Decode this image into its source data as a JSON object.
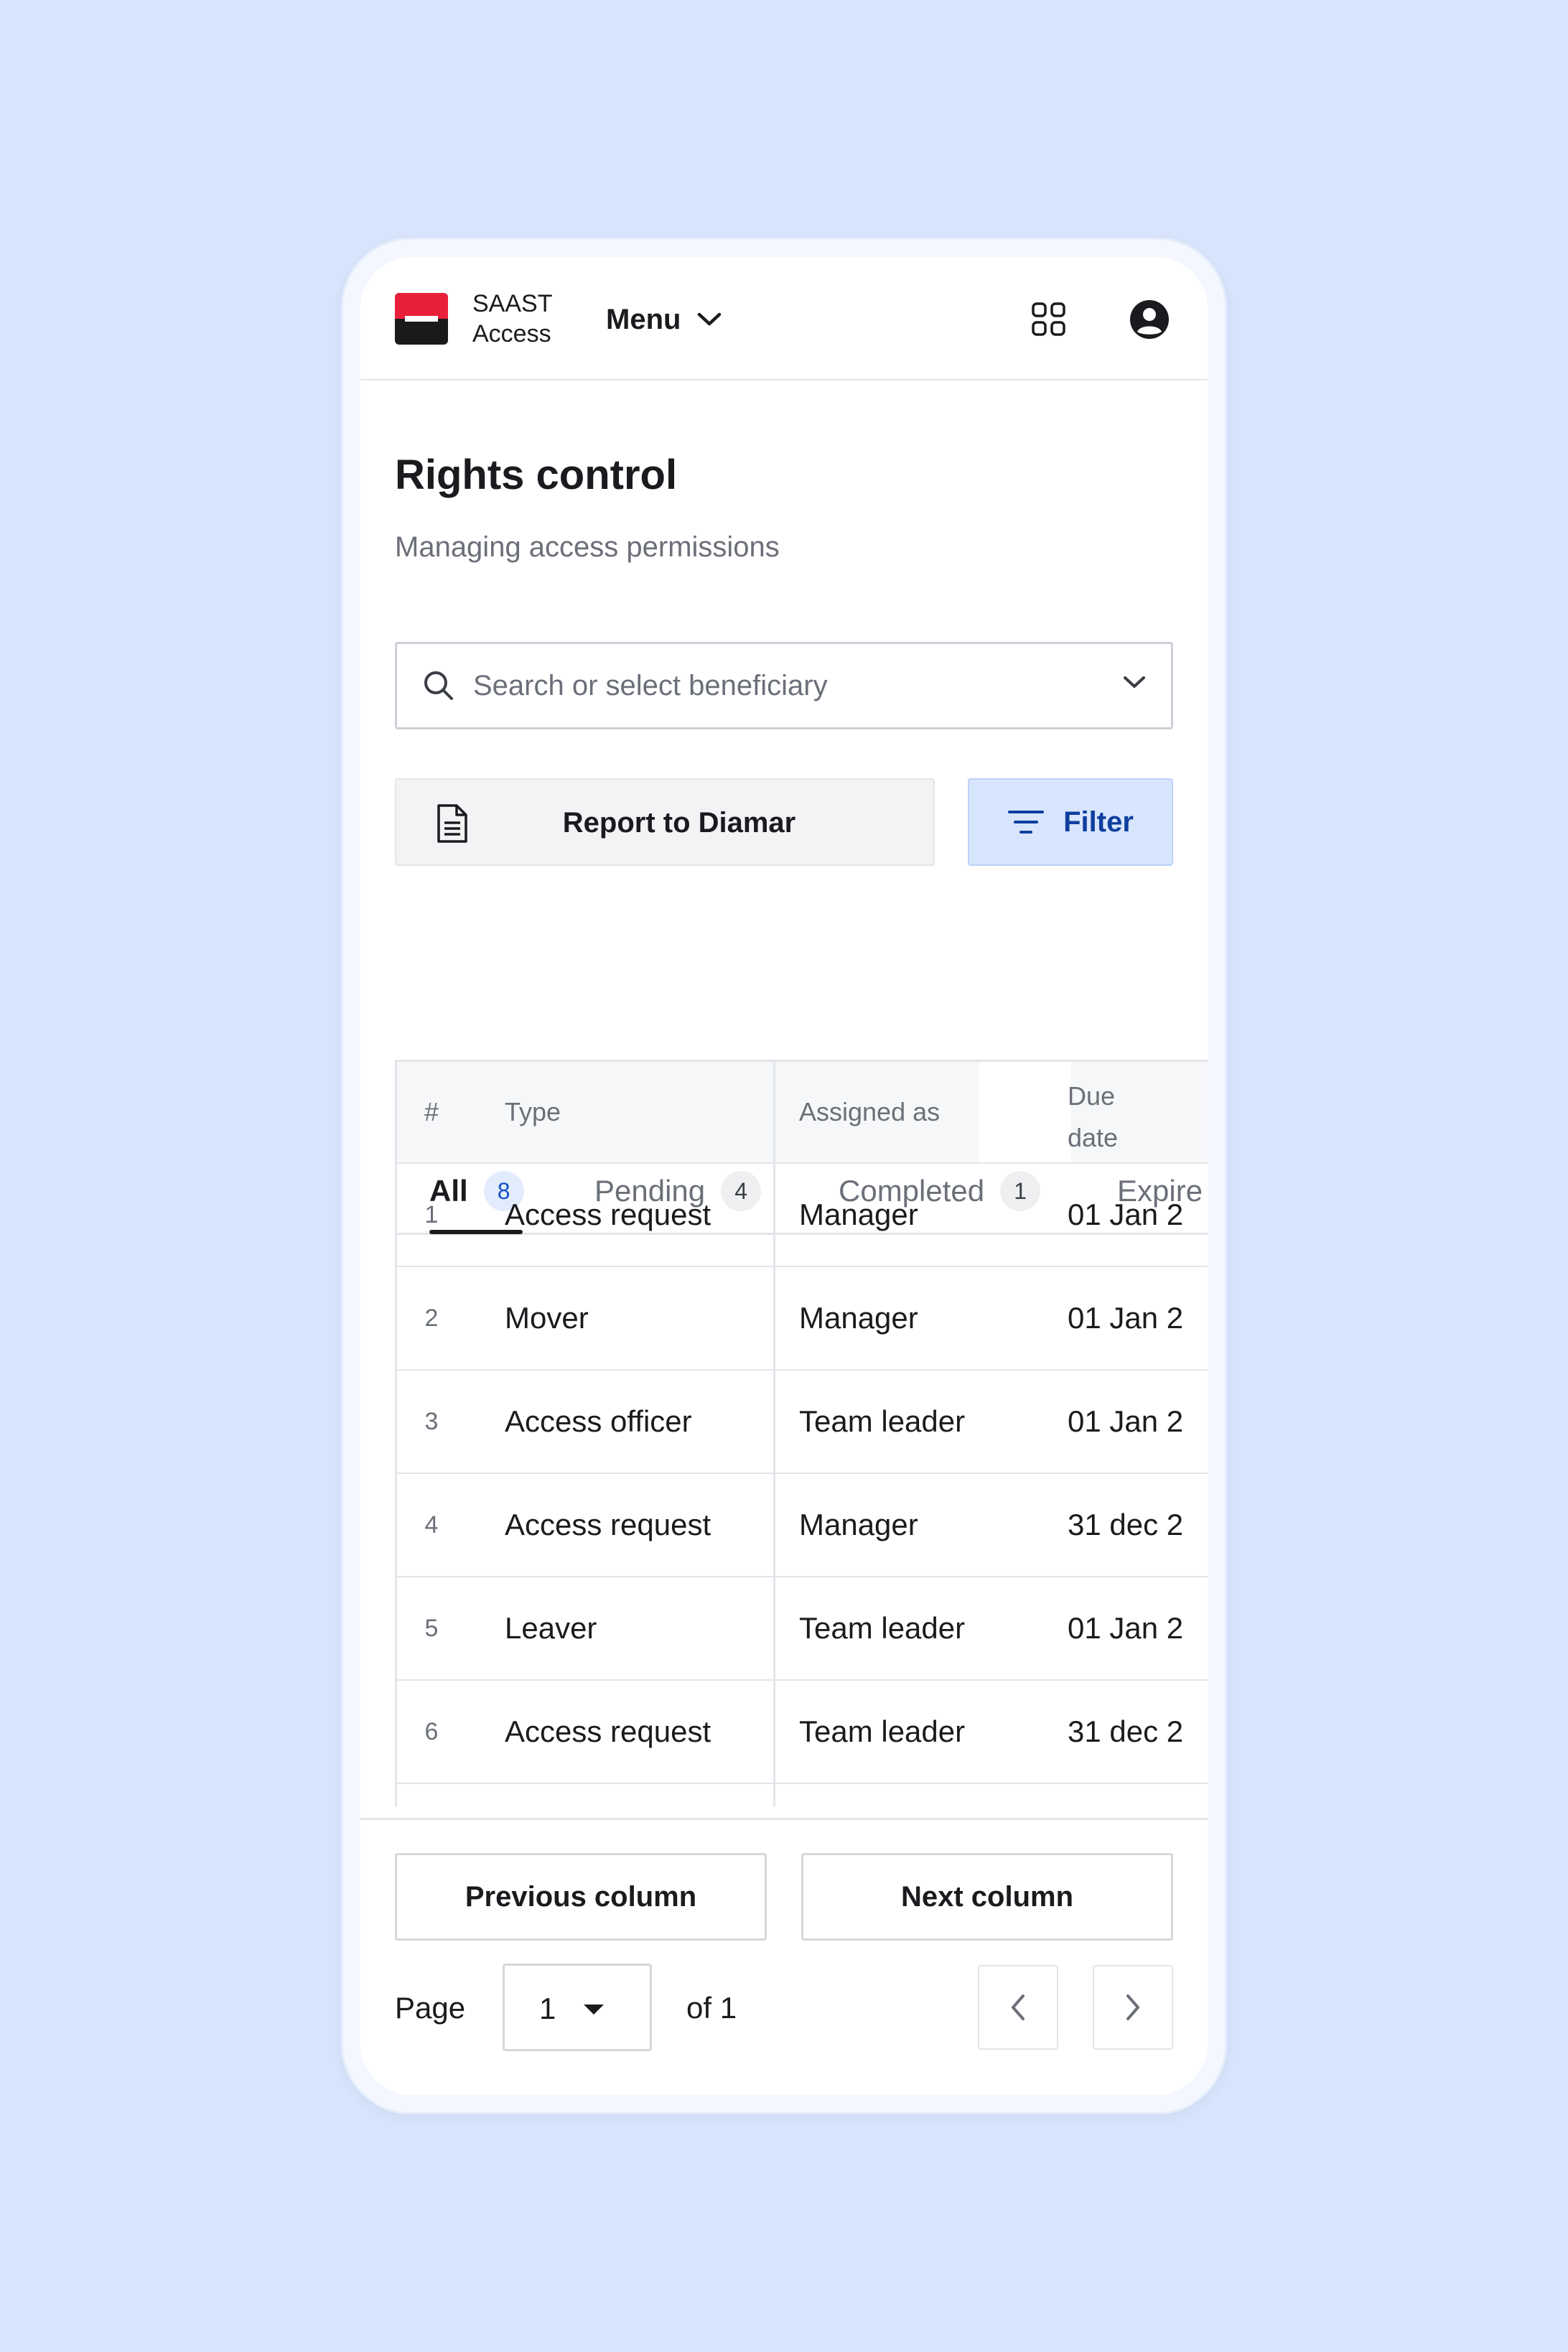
{
  "header": {
    "brand_line1": "SAAST",
    "brand_line2": "Access",
    "menu_label": "Menu"
  },
  "page": {
    "title": "Rights control",
    "subtitle": "Managing access permissions"
  },
  "search": {
    "placeholder": "Search or select beneficiary"
  },
  "actions": {
    "report_label": "Report to Diamar",
    "filter_label": "Filter"
  },
  "tabs": [
    {
      "label": "All",
      "count": "8",
      "active": true
    },
    {
      "label": "Pending",
      "count": "4",
      "active": false
    },
    {
      "label": "Completed",
      "count": "1",
      "active": false
    },
    {
      "label": "Expire",
      "count": "",
      "active": false
    }
  ],
  "table": {
    "headers": {
      "num": "#",
      "type": "Type",
      "assigned": "Assigned as",
      "due_line1": "Due",
      "due_line2": "date"
    },
    "rows": [
      {
        "num": "1",
        "type": "Access request",
        "assigned": "Manager",
        "due": "01 Jan 2"
      },
      {
        "num": "2",
        "type": "Mover",
        "assigned": "Manager",
        "due": "01 Jan 2"
      },
      {
        "num": "3",
        "type": "Access officer",
        "assigned": "Team leader",
        "due": "01 Jan 2"
      },
      {
        "num": "4",
        "type": "Access request",
        "assigned": "Manager",
        "due": "31 dec 2"
      },
      {
        "num": "5",
        "type": "Leaver",
        "assigned": "Team leader",
        "due": "01 Jan 2"
      },
      {
        "num": "6",
        "type": "Access request",
        "assigned": "Team leader",
        "due": "31 dec 2"
      }
    ]
  },
  "footer": {
    "prev_column_label": "Previous column",
    "next_column_label": "Next column",
    "page_label": "Page",
    "page_value": "1",
    "of_label": "of 1"
  },
  "colors": {
    "background": "#d9e5fc",
    "brand_red": "#e8203a",
    "filter_bg": "#d8e6fd",
    "filter_text": "#0f3f9e"
  },
  "icons": {
    "apps": "grid-icon",
    "profile": "user-icon",
    "search": "search-icon",
    "report": "document-icon",
    "filter": "filter-icon"
  }
}
